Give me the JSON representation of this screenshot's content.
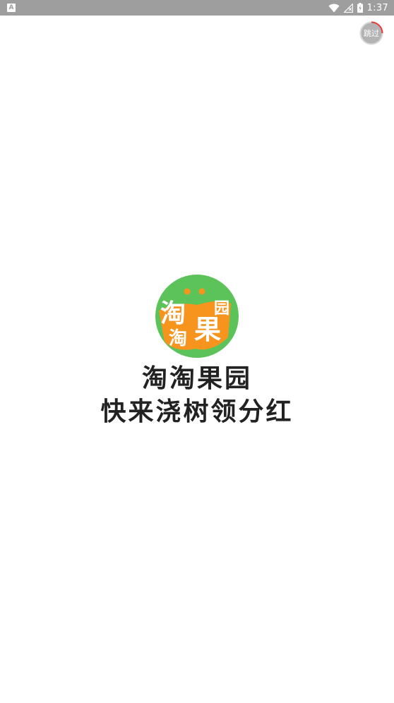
{
  "status_bar": {
    "notification_icon": "A",
    "time": "1:37",
    "icons": [
      "wifi-icon",
      "no-signal-icon",
      "battery-charging-icon"
    ]
  },
  "skip_button": {
    "label": "跳过",
    "countdown_progress": 0.25,
    "ring_color": "#e53935"
  },
  "logo": {
    "line_a": "淘",
    "line_b": "淘",
    "line_c": "果",
    "line_d": "园",
    "circle_color": "#5cc35a",
    "inner_color": "#f7941d"
  },
  "slogan": {
    "line1": "淘淘果园",
    "line2": "快来浇树领分红"
  }
}
